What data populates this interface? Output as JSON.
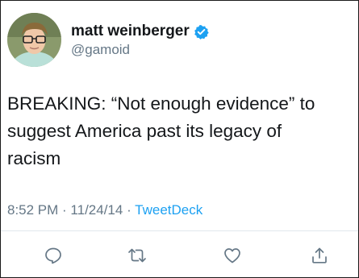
{
  "user": {
    "display_name": "matt weinberger",
    "handle": "@gamoid",
    "verified": true
  },
  "tweet": {
    "text": "BREAKING: “Not enough evidence” to\nsuggest America past its legacy of\nracism"
  },
  "meta": {
    "time": "8:52 PM",
    "separator": " · ",
    "date": "11/24/14",
    "source": "TweetDeck"
  },
  "actions": {
    "reply_icon": "reply-icon",
    "retweet_icon": "retweet-icon",
    "like_icon": "heart-icon",
    "share_icon": "share-icon"
  },
  "colors": {
    "text": "#14171a",
    "secondary": "#657786",
    "accent": "#1da1f2",
    "divider": "#e1e8ed"
  }
}
